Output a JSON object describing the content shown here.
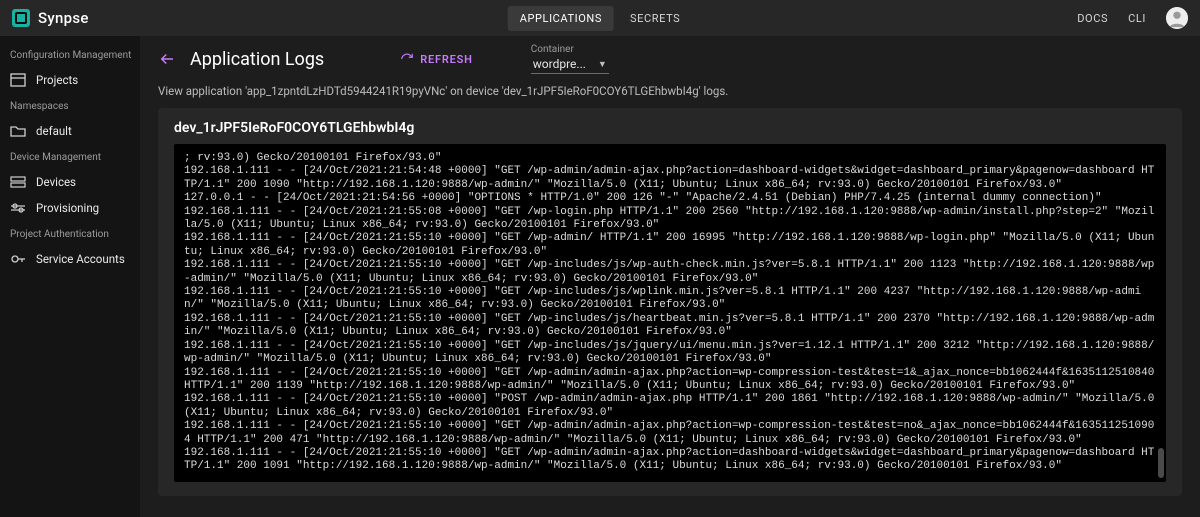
{
  "top": {
    "brand": "Synpse",
    "tabs": [
      {
        "label": "APPLICATIONS",
        "active": true
      },
      {
        "label": "SECRETS",
        "active": false
      }
    ],
    "links": [
      "DOCS",
      "CLI"
    ]
  },
  "sidebar": {
    "groups": [
      {
        "title": "Configuration Management",
        "items": [
          {
            "label": "Projects",
            "icon": "projects-icon"
          }
        ]
      },
      {
        "title": "Namespaces",
        "items": [
          {
            "label": "default",
            "icon": "folder-icon"
          }
        ]
      },
      {
        "title": "Device Management",
        "items": [
          {
            "label": "Devices",
            "icon": "devices-icon"
          },
          {
            "label": "Provisioning",
            "icon": "provisioning-icon"
          }
        ]
      },
      {
        "title": "Project Authentication",
        "items": [
          {
            "label": "Service Accounts",
            "icon": "key-icon"
          }
        ]
      }
    ]
  },
  "page": {
    "title": "Application Logs",
    "refresh_label": "REFRESH",
    "container_field_label": "Container",
    "container_selected": "wordpre...",
    "description": "View application 'app_1zpntdLzHDTd5944241R19pyVNc' on device 'dev_1rJPF5IeRoF0COY6TLGEhbwbI4g' logs."
  },
  "logs": {
    "device": "dev_1rJPF5IeRoF0COY6TLGEhbwbI4g",
    "lines": [
      "; rv:93.0) Gecko/20100101 Firefox/93.0\"",
      "192.168.1.111 - - [24/Oct/2021:21:54:48 +0000] \"GET /wp-admin/admin-ajax.php?action=dashboard-widgets&widget=dashboard_primary&pagenow=dashboard HTTP/1.1\" 200 1090 \"http://192.168.1.120:9888/wp-admin/\" \"Mozilla/5.0 (X11; Ubuntu; Linux x86_64; rv:93.0) Gecko/20100101 Firefox/93.0\"",
      "127.0.0.1 - - [24/Oct/2021:21:54:56 +0000] \"OPTIONS * HTTP/1.0\" 200 126 \"-\" \"Apache/2.4.51 (Debian) PHP/7.4.25 (internal dummy connection)\"",
      "192.168.1.111 - - [24/Oct/2021:21:55:08 +0000] \"GET /wp-login.php HTTP/1.1\" 200 2560 \"http://192.168.1.120:9888/wp-admin/install.php?step=2\" \"Mozilla/5.0 (X11; Ubuntu; Linux x86_64; rv:93.0) Gecko/20100101 Firefox/93.0\"",
      "192.168.1.111 - - [24/Oct/2021:21:55:10 +0000] \"GET /wp-admin/ HTTP/1.1\" 200 16995 \"http://192.168.1.120:9888/wp-login.php\" \"Mozilla/5.0 (X11; Ubuntu; Linux x86_64; rv:93.0) Gecko/20100101 Firefox/93.0\"",
      "192.168.1.111 - - [24/Oct/2021:21:55:10 +0000] \"GET /wp-includes/js/wp-auth-check.min.js?ver=5.8.1 HTTP/1.1\" 200 1123 \"http://192.168.1.120:9888/wp-admin/\" \"Mozilla/5.0 (X11; Ubuntu; Linux x86_64; rv:93.0) Gecko/20100101 Firefox/93.0\"",
      "192.168.1.111 - - [24/Oct/2021:21:55:10 +0000] \"GET /wp-includes/js/wplink.min.js?ver=5.8.1 HTTP/1.1\" 200 4237 \"http://192.168.1.120:9888/wp-admin/\" \"Mozilla/5.0 (X11; Ubuntu; Linux x86_64; rv:93.0) Gecko/20100101 Firefox/93.0\"",
      "192.168.1.111 - - [24/Oct/2021:21:55:10 +0000] \"GET /wp-includes/js/heartbeat.min.js?ver=5.8.1 HTTP/1.1\" 200 2370 \"http://192.168.1.120:9888/wp-admin/\" \"Mozilla/5.0 (X11; Ubuntu; Linux x86_64; rv:93.0) Gecko/20100101 Firefox/93.0\"",
      "192.168.1.111 - - [24/Oct/2021:21:55:10 +0000] \"GET /wp-includes/js/jquery/ui/menu.min.js?ver=1.12.1 HTTP/1.1\" 200 3212 \"http://192.168.1.120:9888/wp-admin/\" \"Mozilla/5.0 (X11; Ubuntu; Linux x86_64; rv:93.0) Gecko/20100101 Firefox/93.0\"",
      "192.168.1.111 - - [24/Oct/2021:21:55:10 +0000] \"GET /wp-admin/admin-ajax.php?action=wp-compression-test&test=1&_ajax_nonce=bb1062444f&1635112510840 HTTP/1.1\" 200 1139 \"http://192.168.1.120:9888/wp-admin/\" \"Mozilla/5.0 (X11; Ubuntu; Linux x86_64; rv:93.0) Gecko/20100101 Firefox/93.0\"",
      "192.168.1.111 - - [24/Oct/2021:21:55:10 +0000] \"POST /wp-admin/admin-ajax.php HTTP/1.1\" 200 1861 \"http://192.168.1.120:9888/wp-admin/\" \"Mozilla/5.0 (X11; Ubuntu; Linux x86_64; rv:93.0) Gecko/20100101 Firefox/93.0\"",
      "192.168.1.111 - - [24/Oct/2021:21:55:10 +0000] \"GET /wp-admin/admin-ajax.php?action=wp-compression-test&test=no&_ajax_nonce=bb1062444f&1635112510904 HTTP/1.1\" 200 471 \"http://192.168.1.120:9888/wp-admin/\" \"Mozilla/5.0 (X11; Ubuntu; Linux x86_64; rv:93.0) Gecko/20100101 Firefox/93.0\"",
      "192.168.1.111 - - [24/Oct/2021:21:55:10 +0000] \"GET /wp-admin/admin-ajax.php?action=dashboard-widgets&widget=dashboard_primary&pagenow=dashboard HTTP/1.1\" 200 1091 \"http://192.168.1.120:9888/wp-admin/\" \"Mozilla/5.0 (X11; Ubuntu; Linux x86_64; rv:93.0) Gecko/20100101 Firefox/93.0\""
    ]
  }
}
